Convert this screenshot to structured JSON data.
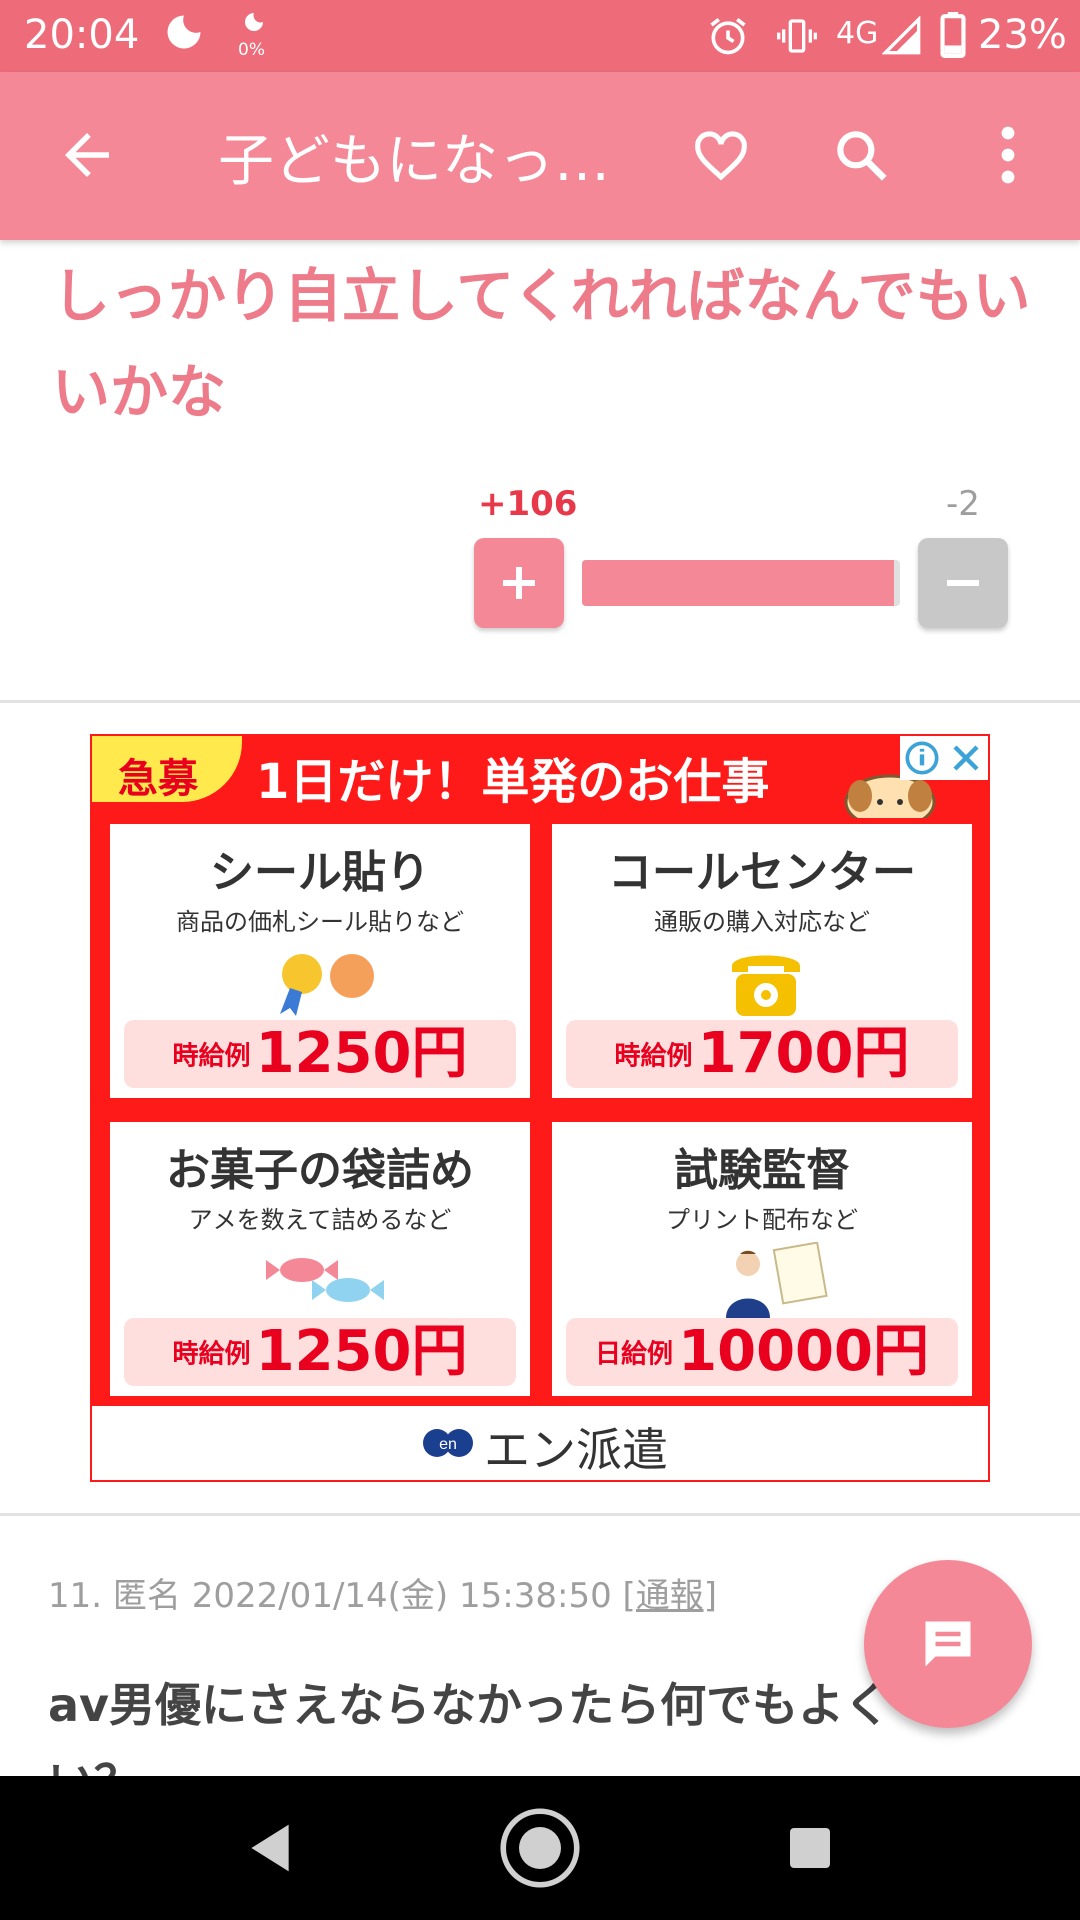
{
  "status_bar": {
    "time": "20:04",
    "data_saver": "0%",
    "network": "4G",
    "battery": "23%"
  },
  "app_bar": {
    "title": "子どもになっ…",
    "icons": [
      "back-arrow-icon",
      "heart-icon",
      "search-icon",
      "more-vert-icon"
    ]
  },
  "comment": {
    "text": "しっかり自立してくれればなんでもいいかな",
    "plus_count": "+106",
    "minus_count": "-2",
    "plus_label": "+",
    "minus_label": "−",
    "positive_ratio": 0.98
  },
  "ad": {
    "urgent": "急募",
    "headline": "1日だけ！単発のお仕事",
    "cards": [
      {
        "title": "シール貼り",
        "subtitle": "商品の価札シール貼りなど",
        "pay_label": "時給例",
        "pay_value": "1250円"
      },
      {
        "title": "コールセンター",
        "subtitle": "通販の購入対応など",
        "pay_label": "時給例",
        "pay_value": "1700円"
      },
      {
        "title": "お菓子の袋詰め",
        "subtitle": "アメを数えて詰めるなど",
        "pay_label": "時給例",
        "pay_value": "1250円"
      },
      {
        "title": "試験監督",
        "subtitle": "プリント配布など",
        "pay_label": "日給例",
        "pay_value": "10000円"
      }
    ],
    "logo_text": "en",
    "brand": "エン派遣",
    "colors": {
      "background": "#ff1a1a",
      "accent": "#ffe94d",
      "pay_bg": "#ffdede"
    }
  },
  "next_comment": {
    "number": "11.",
    "author": "匿名",
    "date": "2022/01/14(金) 15:38:50",
    "report_label": "[通報]",
    "text": "av男優にさえならなかったら何でもよく",
    "tail": "い？"
  },
  "colors": {
    "primary": "#f48896",
    "status_bar": "#ee6c7a",
    "comment_text": "#ee7b8a",
    "plus": "#e8394b"
  }
}
